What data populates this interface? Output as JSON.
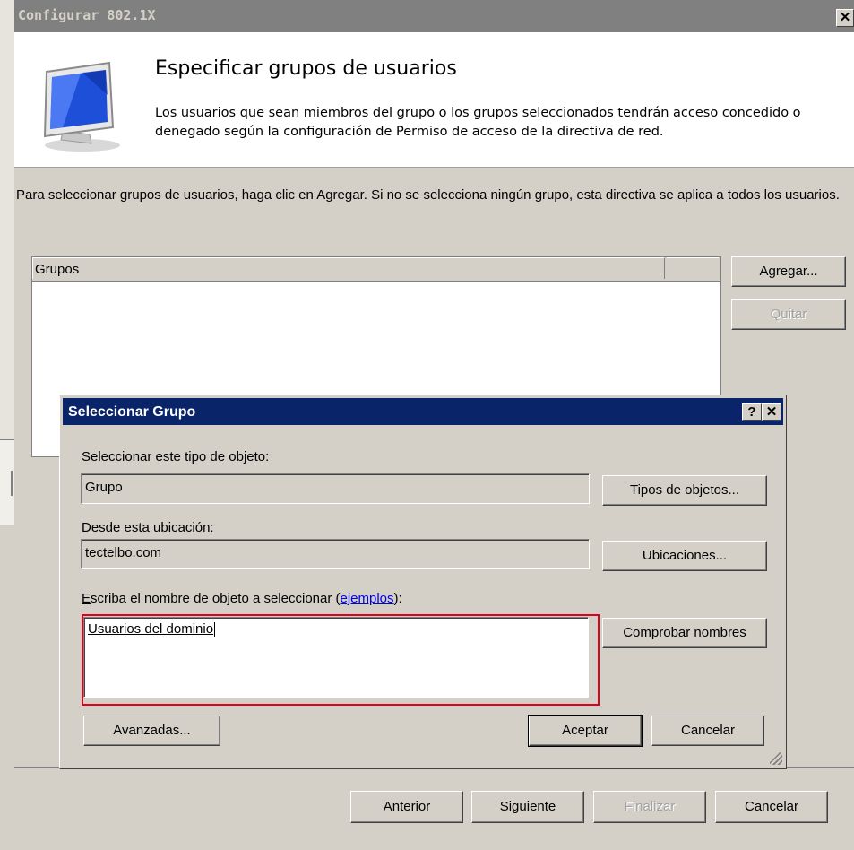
{
  "wizard": {
    "title": "Configurar 802.1X",
    "close_symbol": "✕",
    "heading": "Especificar grupos de usuarios",
    "description": "Los usuarios que sean miembros del grupo o los grupos seleccionados tendrán acceso concedido o denegado según la configuración de Permiso de acceso de la directiva de red.",
    "instructions": "Para seleccionar grupos de usuarios, haga clic en Agregar. Si no se selecciona ningún grupo, esta directiva se aplica a todos los usuarios.",
    "groups_column": "Grupos",
    "add_button": "Agregar...",
    "remove_button": "Quitar",
    "back_button": "Anterior",
    "next_button": "Siguiente",
    "finish_button": "Finalizar",
    "cancel_button": "Cancelar"
  },
  "dialog": {
    "title": "Seleccionar Grupo",
    "help_symbol": "?",
    "close_symbol": "✕",
    "object_type_label": "Seleccionar este tipo de objeto:",
    "object_type_value": "Grupo",
    "object_types_button": "Tipos de objetos...",
    "location_label": "Desde esta ubicación:",
    "location_value": "tectelbo.com",
    "locations_button": "Ubicaciones...",
    "names_label_access": "E",
    "names_label_rest": "scriba el nombre de objeto a seleccionar (",
    "examples_link": "ejemplos",
    "names_label_end": "):",
    "names_value": "Usuarios del dominio",
    "check_names_button": "Comprobar nombres",
    "advanced_button": "Avanzadas...",
    "ok_button": "Aceptar",
    "cancel_button": "Cancelar"
  },
  "colors": {
    "dialog_titlebar": "#0a246a",
    "wizard_titlebar_inactive": "#808080",
    "highlight": "#e0001c",
    "face": "#d4d0c8"
  }
}
